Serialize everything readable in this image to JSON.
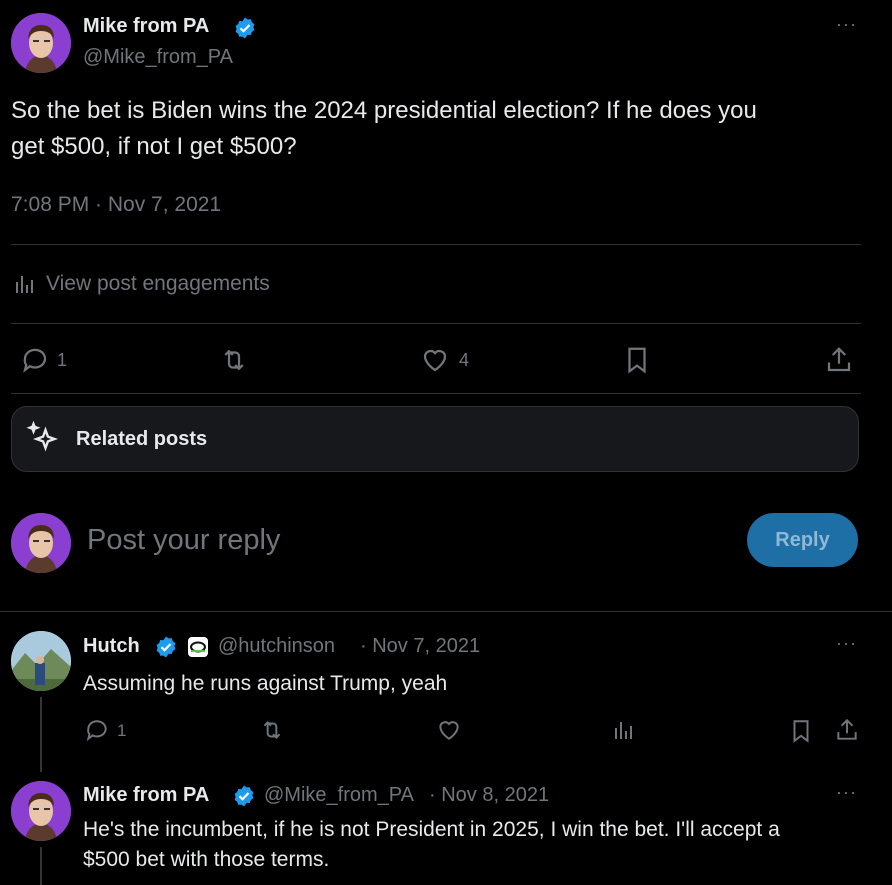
{
  "main_post": {
    "author_name": "Mike from PA",
    "author_handle": "@Mike_from_PA",
    "more": "···",
    "text_line1": "So the bet is Biden wins the 2024 presidential election? If he does you",
    "text_line2": "get $500, if not I get $500?",
    "timestamp": "7:08 PM · Nov 7, 2021",
    "engagements_label": "View post engagements",
    "actions": {
      "reply_count": "1",
      "repost_count": "",
      "like_count": "4"
    }
  },
  "related_posts": {
    "label": "Related posts"
  },
  "composer": {
    "placeholder": "Post your reply",
    "reply_button": "Reply"
  },
  "replies": [
    {
      "author_name": "Hutch",
      "author_handle": "@hutchinson",
      "date": "· Nov 7, 2021",
      "more": "···",
      "text": "Assuming he runs against Trump, yeah",
      "reply_count": "1"
    },
    {
      "author_name": "Mike from PA",
      "author_handle": "@Mike_from_PA",
      "date": "· Nov 8, 2021",
      "more": "···",
      "text_line1": "He's the incumbent, if he is not President in 2025, I win the bet. I'll accept a",
      "text_line2": "$500 bet with those terms."
    }
  ],
  "icons": {
    "verified": "verified-badge-icon",
    "affiliate": "optic-affiliate-icon",
    "reply": "reply-icon",
    "repost": "repost-icon",
    "like": "heart-icon",
    "bookmark": "bookmark-icon",
    "share": "share-icon",
    "views": "analytics-icon",
    "sparkle": "sparkle-icon"
  },
  "colors": {
    "background": "#000000",
    "text": "#e7e9ea",
    "secondary_text": "#71767b",
    "border": "#2f3336",
    "verified_blue": "#1d9bf0",
    "reply_button_bg": "#1d6fa5",
    "reply_button_text": "#8fb8d6",
    "card_bg": "#16181c"
  }
}
